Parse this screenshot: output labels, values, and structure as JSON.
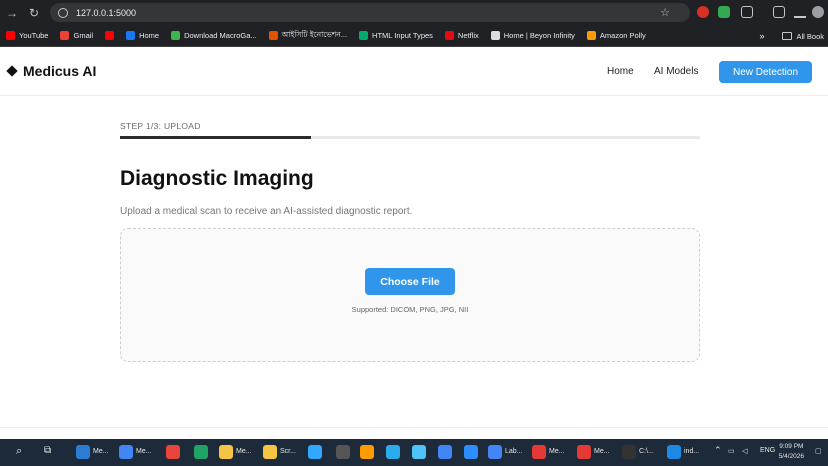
{
  "browser": {
    "url": "127.0.0.1:5000",
    "bookmarks": [
      {
        "label": "YouTube",
        "color": "#ff0000"
      },
      {
        "label": "Gmail",
        "color": "#ea4335"
      },
      {
        "label": "",
        "color": "#ff0000"
      },
      {
        "label": "Home",
        "color": "#1877f2"
      },
      {
        "label": "Download MacroGa...",
        "color": "#3fb34f"
      },
      {
        "label": "আইসিটি ইনোভেশন...",
        "color": "#e65100"
      },
      {
        "label": "HTML Input Types",
        "color": "#04aa6d"
      },
      {
        "label": "Netflix",
        "color": "#e50914"
      },
      {
        "label": "Home | Beyon Infinity",
        "color": "#dddddd"
      },
      {
        "label": "Amazon Polly",
        "color": "#ff9900"
      }
    ],
    "chevron": "»",
    "all_bookmarks": "All Book"
  },
  "app": {
    "brand": "Medicus AI",
    "nav": {
      "home": "Home",
      "models": "AI Models",
      "cta": "New Detection"
    },
    "step": {
      "label": "STEP 1/3: UPLOAD",
      "progress": 0.33
    },
    "title": "Diagnostic Imaging",
    "subtitle": "Upload a medical scan to receive an AI-assisted diagnostic report.",
    "upload": {
      "button": "Choose File",
      "supported": "Supported: DICOM, PNG, JPG, NII"
    }
  },
  "taskbar": {
    "apps": [
      {
        "label": "Me...",
        "color": "#2b7cd3"
      },
      {
        "label": "Me...",
        "color": "#4285f4"
      },
      {
        "label": "",
        "color": "#e8453c"
      },
      {
        "label": "",
        "color": "#21a366"
      },
      {
        "label": "Me...",
        "color": "#f4c542"
      },
      {
        "label": "Scr...",
        "color": "#f4c542"
      },
      {
        "label": "",
        "color": "#31a8ff"
      },
      {
        "label": "",
        "color": "#555555"
      },
      {
        "label": "",
        "color": "#ff9a00"
      },
      {
        "label": "",
        "color": "#2aabee"
      },
      {
        "label": "",
        "color": "#4fc3f7"
      },
      {
        "label": "",
        "color": "#4285f4"
      },
      {
        "label": "",
        "color": "#2d8cff"
      },
      {
        "label": "Lab...",
        "color": "#4285f4"
      },
      {
        "label": "Me...",
        "color": "#e53935"
      },
      {
        "label": "Me...",
        "color": "#e53935"
      },
      {
        "label": "C:\\...",
        "color": "#333333"
      },
      {
        "label": "ind...",
        "color": "#1e88e5"
      }
    ],
    "lang": "ENG",
    "time": "9:09 PM",
    "date": "5/4/2026"
  }
}
